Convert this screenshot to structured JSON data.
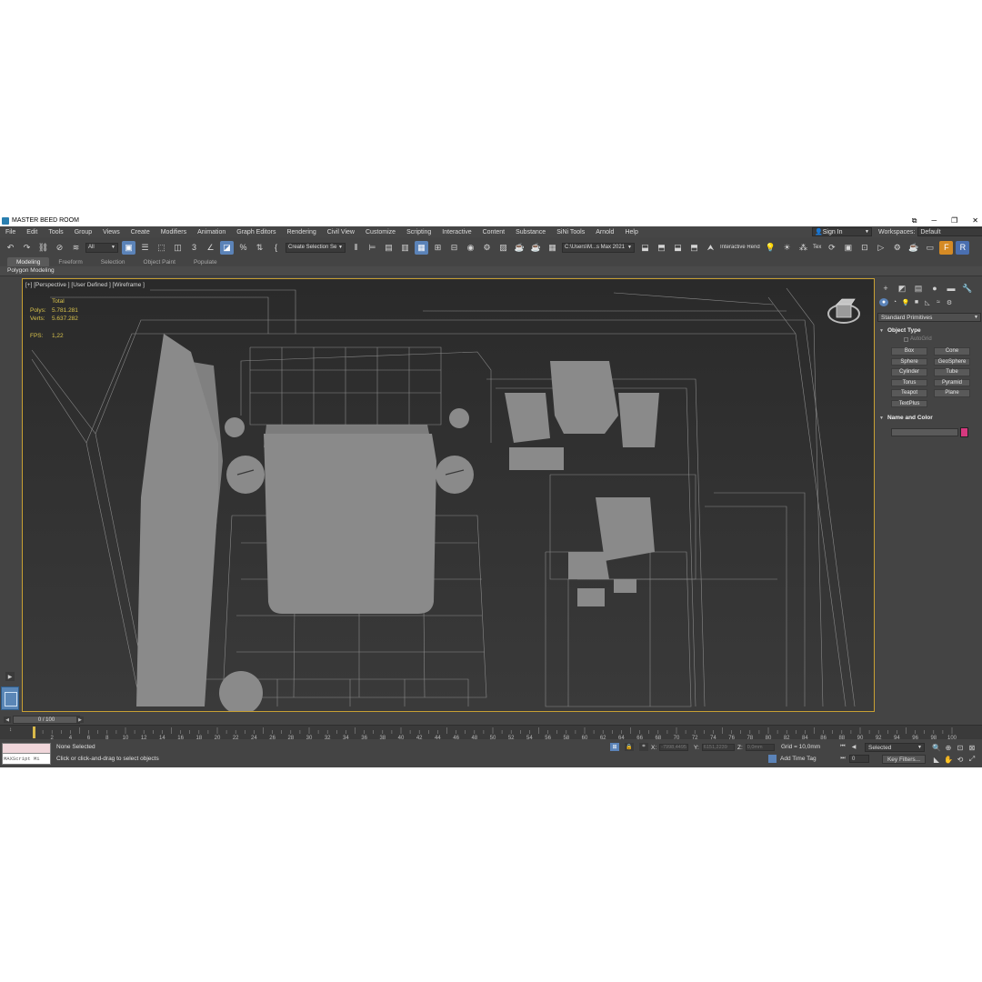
{
  "window": {
    "title": "MASTER BEED ROOM",
    "controls": [
      "⧉",
      "─",
      "❐",
      "✕"
    ]
  },
  "menu": {
    "items": [
      "File",
      "Edit",
      "Tools",
      "Group",
      "Views",
      "Create",
      "Modifiers",
      "Animation",
      "Graph Editors",
      "Rendering",
      "Civil View",
      "Customize",
      "Scripting",
      "Interactive",
      "Content",
      "Substance",
      "SiNi Tools",
      "Arnold",
      "Help"
    ],
    "sign_in": "Sign In",
    "workspaces_label": "Workspaces:",
    "workspaces_value": "Default"
  },
  "toolbar": {
    "filter_value": "All",
    "selection_set": "Create Selection Se",
    "project_path": "C:\\Users\\M...s Max 2021",
    "interactive_render": "Interactive Rendering",
    "tex_label": "Tex"
  },
  "ribbon": {
    "tabs": [
      "Modeling",
      "Freeform",
      "Selection",
      "Object Paint",
      "Populate"
    ],
    "panel_label": "Polygon Modeling"
  },
  "viewport": {
    "label": "[+] [Perspective ] [User Defined ] [Wireframe ]",
    "stats": {
      "total_label": "Total",
      "polys_label": "Polys:",
      "polys_value": "5.781.281",
      "verts_label": "Verts:",
      "verts_value": "5.637.282",
      "fps_label": "FPS:",
      "fps_value": "1,22"
    }
  },
  "command_panel": {
    "category": "Standard Primitives",
    "object_type_title": "Object Type",
    "autogrid_label": "AutoGrid",
    "primitives": [
      "Box",
      "Cone",
      "Sphere",
      "GeoSphere",
      "Cylinder",
      "Tube",
      "Torus",
      "Pyramid",
      "Teapot",
      "Plane",
      "TextPlus"
    ],
    "name_color_title": "Name and Color",
    "color": "#d6397f"
  },
  "timeline": {
    "frame_display": "0 / 100",
    "tick_labels": [
      "0",
      "2",
      "4",
      "6",
      "8",
      "10",
      "12",
      "14",
      "16",
      "18",
      "20",
      "22",
      "24",
      "26",
      "28",
      "30",
      "32",
      "34",
      "36",
      "38",
      "40",
      "42",
      "44",
      "46",
      "48",
      "50",
      "52",
      "54",
      "56",
      "58",
      "60",
      "62",
      "64",
      "66",
      "68",
      "70",
      "72",
      "74",
      "76",
      "78",
      "80",
      "82",
      "84",
      "86",
      "88",
      "90",
      "92",
      "94",
      "96",
      "98",
      "100"
    ]
  },
  "status": {
    "maxscript_label": "MAXScript Mi",
    "selection_text": "None Selected",
    "prompt_text": "Click or click-and-drag to select objects",
    "x_label": "X:",
    "x_value": "-7998,4495",
    "y_label": "Y:",
    "y_value": "6151,2239",
    "z_label": "Z:",
    "z_value": "0,0mm",
    "grid_text": "Grid = 10,0mm",
    "add_time_tag": "Add Time Tag",
    "selected_dropdown": "Selected",
    "key_filters": "Key Filters...",
    "current_frame": "0"
  },
  "colors": {
    "accent": "#5b83b8",
    "viewport_border": "#c8a033",
    "stats_text": "#d8c24c"
  }
}
